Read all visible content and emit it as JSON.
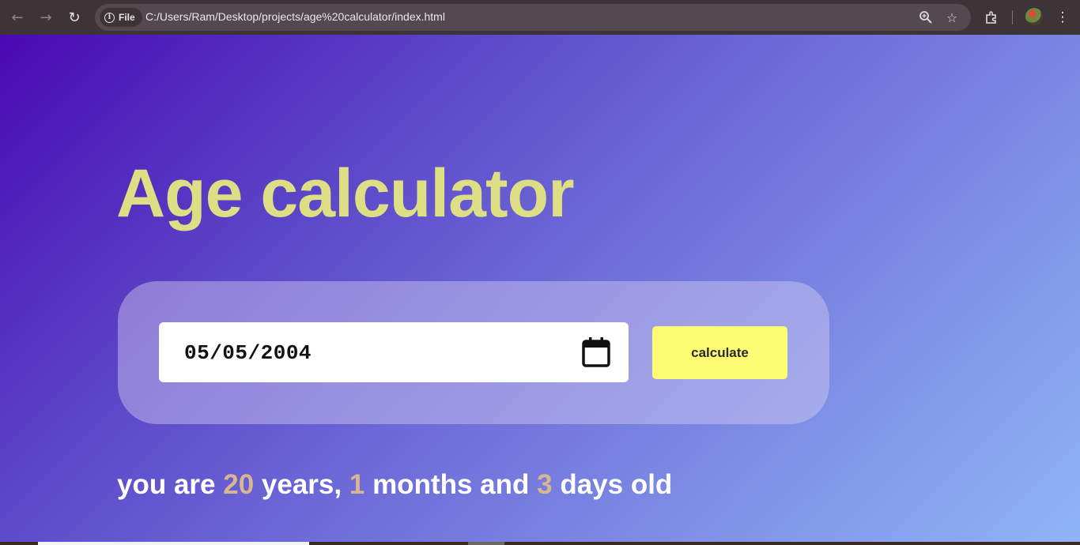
{
  "browser": {
    "back_icon": "arrow-left-icon",
    "forward_icon": "arrow-right-icon",
    "reload_icon": "reload-icon",
    "site_info_label": "File",
    "url": "C:/Users/Ram/Desktop/projects/age%20calculator/index.html"
  },
  "page": {
    "title": "Age calculator",
    "date_value": "05/05/2004",
    "calculate_label": "calculate",
    "result": {
      "prefix": "you are",
      "years": "20",
      "years_label": "years,",
      "months": "1",
      "months_label": "months and",
      "days": "3",
      "days_label": "days old"
    }
  },
  "colors": {
    "title": "#dede84",
    "button": "#fdfc73",
    "number_highlight": "#d9b68f",
    "gradient_start": "#4a08b4",
    "gradient_end": "#8fb4f8"
  }
}
